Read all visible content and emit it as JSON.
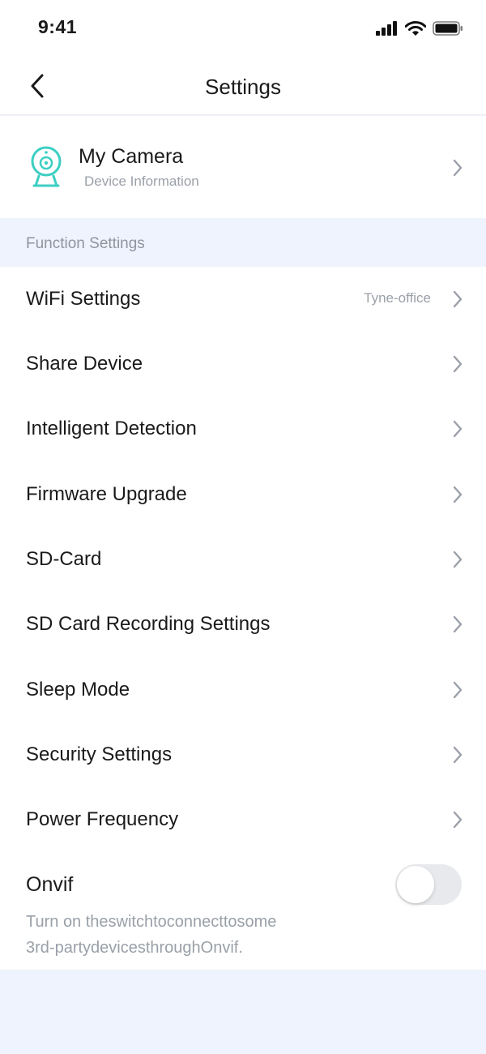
{
  "status_bar": {
    "time": "9:41"
  },
  "nav": {
    "title": "Settings"
  },
  "device": {
    "name": "My Camera",
    "subtitle": "Device Information"
  },
  "section": {
    "title": "Function Settings"
  },
  "rows": [
    {
      "label": "WiFi Settings",
      "value": "Tyne-office"
    },
    {
      "label": "Share Device"
    },
    {
      "label": "Intelligent Detection"
    },
    {
      "label": "Firmware Upgrade"
    },
    {
      "label": "SD-Card"
    },
    {
      "label": "SD Card Recording Settings"
    },
    {
      "label": "Sleep Mode"
    },
    {
      "label": "Security Settings"
    },
    {
      "label": "Power Frequency"
    }
  ],
  "onvif": {
    "label": "Onvif",
    "enabled": false,
    "description_line1": "Turn on theswitchtoconnecttosome",
    "description_line2": "3rd-partydevicesthroughOnvif."
  },
  "colors": {
    "accent": "#3ccfc3",
    "background": "#eef3fd",
    "text": "#1a1a1a",
    "secondary_text": "#9aa0a8"
  },
  "icons": [
    "signal-icon",
    "wifi-icon",
    "battery-icon",
    "back-chevron-icon",
    "camera-icon",
    "chevron-right-icon"
  ]
}
